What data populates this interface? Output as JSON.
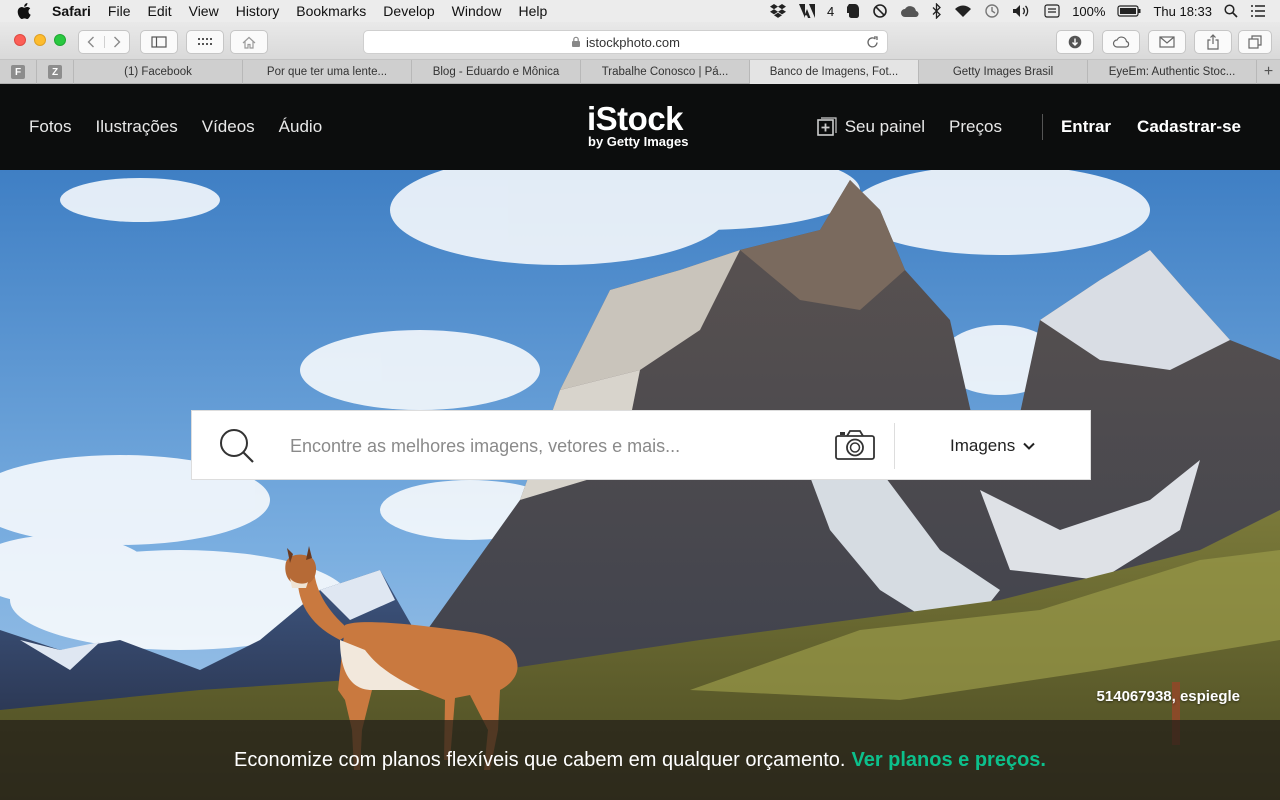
{
  "menubar": {
    "items": [
      "Safari",
      "File",
      "Edit",
      "View",
      "History",
      "Bookmarks",
      "Develop",
      "Window",
      "Help"
    ],
    "adobe_count": "4",
    "battery": "100%",
    "clock": "Thu 18:33"
  },
  "browser": {
    "url": "istockphoto.com",
    "pinned_tabs": [
      "F",
      "Z"
    ],
    "tabs": [
      "(1) Facebook",
      "Por que ter uma lente...",
      "Blog - Eduardo e Mônica",
      "Trabalhe Conosco | Pá...",
      "Banco de Imagens, Fot...",
      "Getty Images Brasil",
      "EyeEm: Authentic Stoc..."
    ],
    "active_tab_index": 4,
    "new_tab": "+"
  },
  "site": {
    "nav": [
      "Fotos",
      "Ilustrações",
      "Vídeos",
      "Áudio"
    ],
    "logo": "iStock",
    "logo_sub": "by Getty Images",
    "dashboard": "Seu painel",
    "pricing": "Preços",
    "signin": "Entrar",
    "signup": "Cadastrar-se"
  },
  "search": {
    "placeholder": "Encontre as melhores imagens, vetores e mais...",
    "filter": "Imagens"
  },
  "hero": {
    "credit": "514067938, espiegle",
    "promo_text": "Economize com planos flexíveis que cabem em qualquer orçamento.",
    "promo_link": "Ver planos e preços."
  },
  "colors": {
    "header_bg": "#0c0d0d",
    "promo_link": "#0cc08c",
    "close": "#fc5f57",
    "minimize": "#fdbc2e",
    "zoom": "#29c840"
  },
  "icons": [
    "apple-icon",
    "search-icon",
    "camera-icon",
    "chevron-down-icon",
    "plus-square-icon",
    "reload-icon",
    "lock-icon"
  ]
}
